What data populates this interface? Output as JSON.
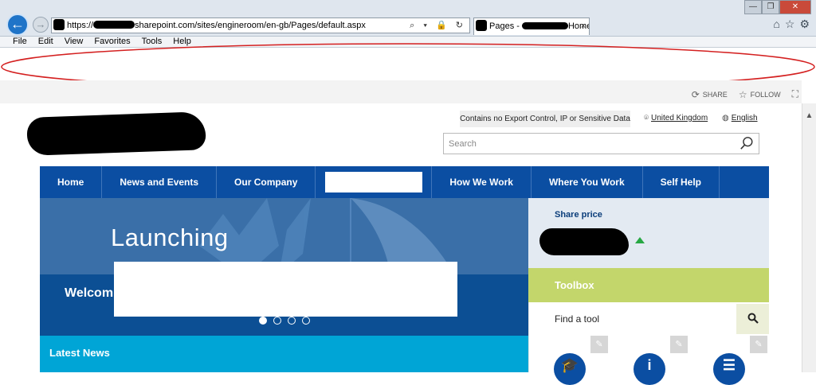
{
  "browser": {
    "address_prefix": "https://",
    "address_rest": "sharepoint.com/sites/engineroom/en-gb/Pages/default.aspx",
    "address_tools": "⌕ ▾ 🔒 ↻",
    "tab_prefix": "Pages - ",
    "tab_suffix": "Home",
    "tab_close": "×",
    "menu": [
      "File",
      "Edit",
      "View",
      "Favorites",
      "Tools",
      "Help"
    ]
  },
  "page_actions": {
    "share": "SHARE",
    "follow": "FOLLOW"
  },
  "header": {
    "export_notice": "Contains no Export Control, IP or Sensitive Data",
    "country": "United Kingdom",
    "language": "English",
    "search_placeholder": "Search"
  },
  "nav": {
    "items": [
      "Home",
      "News and Events",
      "Our Company",
      "How We Work",
      "Where You Work",
      "Self Help"
    ]
  },
  "hero": {
    "title": "Launching",
    "welcome": "Welcom",
    "slide_count": 4,
    "active_slide": 1
  },
  "latest_news": {
    "title": "Latest News"
  },
  "share_price": {
    "label": "Share price"
  },
  "toolbox": {
    "title": "Toolbox",
    "find_label": "Find a tool"
  },
  "colors": {
    "nav_blue": "#0b4ea2",
    "latest_news_cyan": "#00a5d6",
    "toolbox_green": "#c3d66b",
    "share_bg": "#e3eaf2",
    "annotation_red": "#d42020"
  }
}
